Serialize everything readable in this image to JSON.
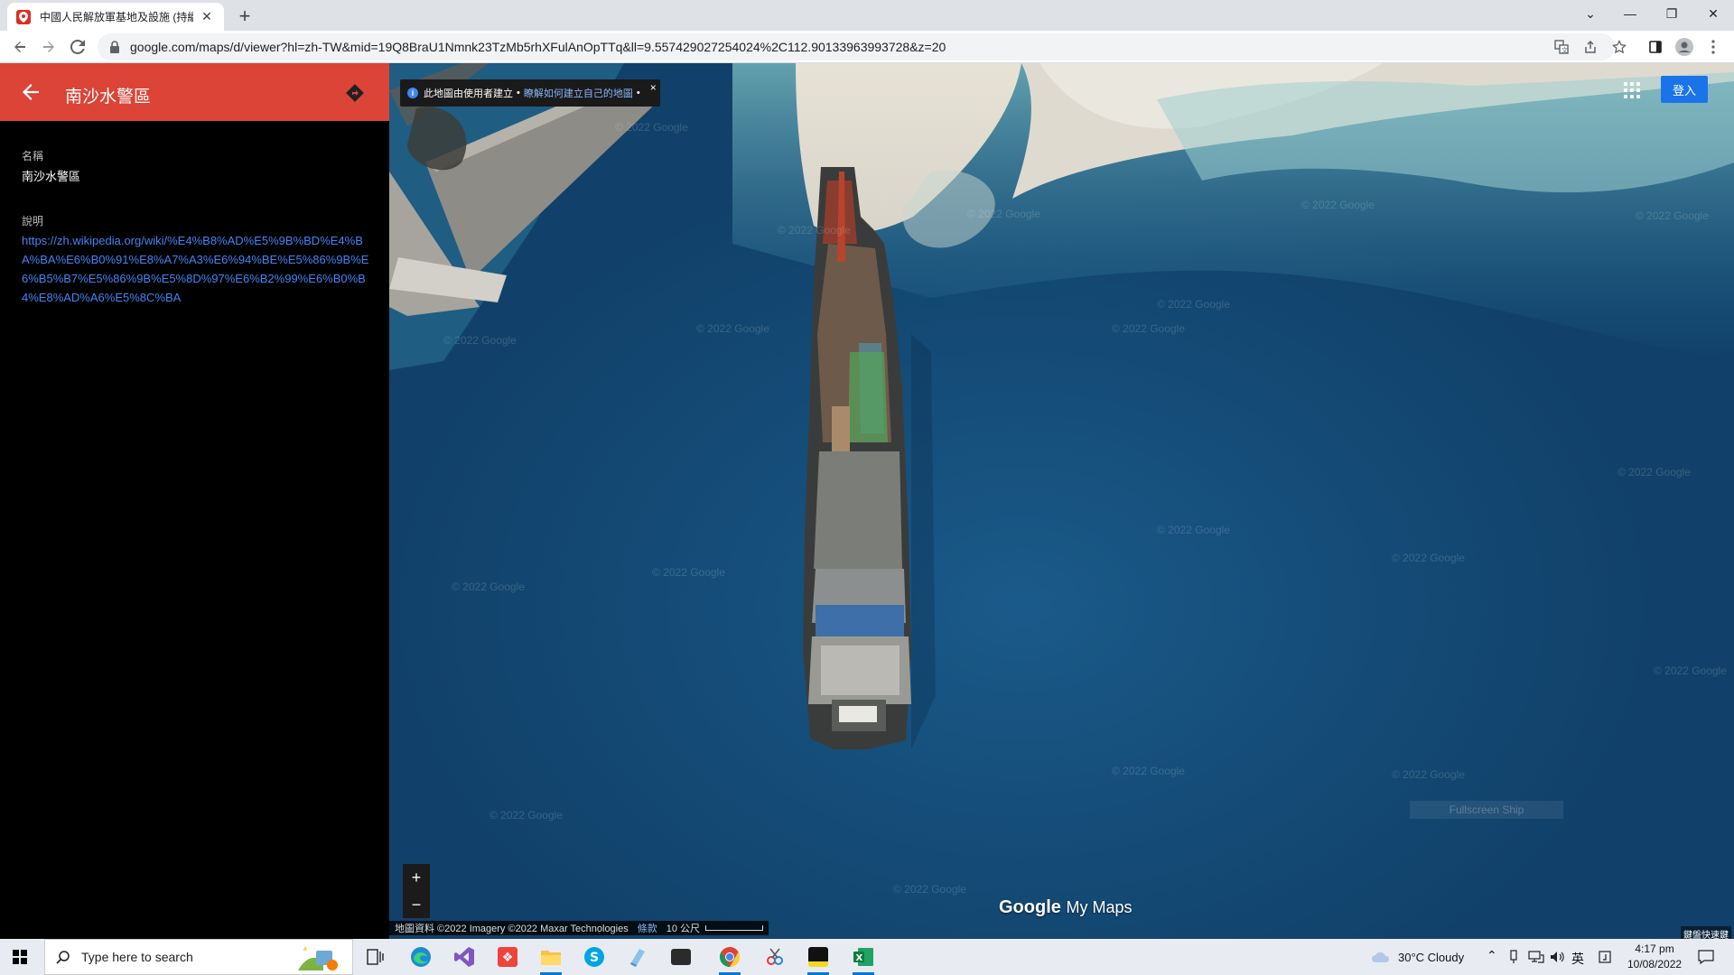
{
  "browser": {
    "tab_title": "中國人民解放軍基地及設施 (持續...",
    "new_tab": "+",
    "url": "google.com/maps/d/viewer?hl=zh-TW&mid=19Q8BraU1Nmnk23TzMb5rhXFulAnOpTTq&ll=9.557429027254024%2C112.90133963993728&z=20",
    "window_controls": {
      "dropdown": "⌄",
      "minimize": "—",
      "restore": "❐",
      "close": "✕"
    }
  },
  "panel": {
    "title": "南沙水警區",
    "name_label": "名稱",
    "name_value": "南沙水警區",
    "desc_label": "說明",
    "desc_link": "https://zh.wikipedia.org/wiki/%E4%B8%AD%E5%9B%BD%E4%BA%BA%E6%B0%91%E8%A7%A3%E6%94%BE%E5%86%9B%E6%B5%B7%E5%86%9B%E5%8D%97%E6%B2%99%E6%B0%B4%E8%AD%A6%E5%8C%BA"
  },
  "map": {
    "info_text": "此地圖由使用者建立",
    "info_sep": "•",
    "info_link": "瞭解如何建立自己的地圖",
    "info_close": "×",
    "signin_label": "登入",
    "zoom_in": "+",
    "zoom_out": "−",
    "logo_google": "Google",
    "logo_mymaps": "My Maps",
    "attribution": "地圖資料 ©2022 Imagery ©2022 Maxar Technologies",
    "terms": "條款",
    "scale": "10 公尺",
    "fullscreen_label": "Fullscreen Ship",
    "corner_label": "鍵盤快速鍵",
    "watermark": "© 2022 Google"
  },
  "taskbar": {
    "search_placeholder": "Type here to search",
    "weather": "30°C  Cloudy",
    "ime": "英",
    "time": "4:17 pm",
    "date": "10/08/2022"
  },
  "colors": {
    "header_red": "#db4437",
    "link_blue": "#4285f4",
    "signin_blue": "#1a73e8",
    "sea": "#164f7c"
  }
}
